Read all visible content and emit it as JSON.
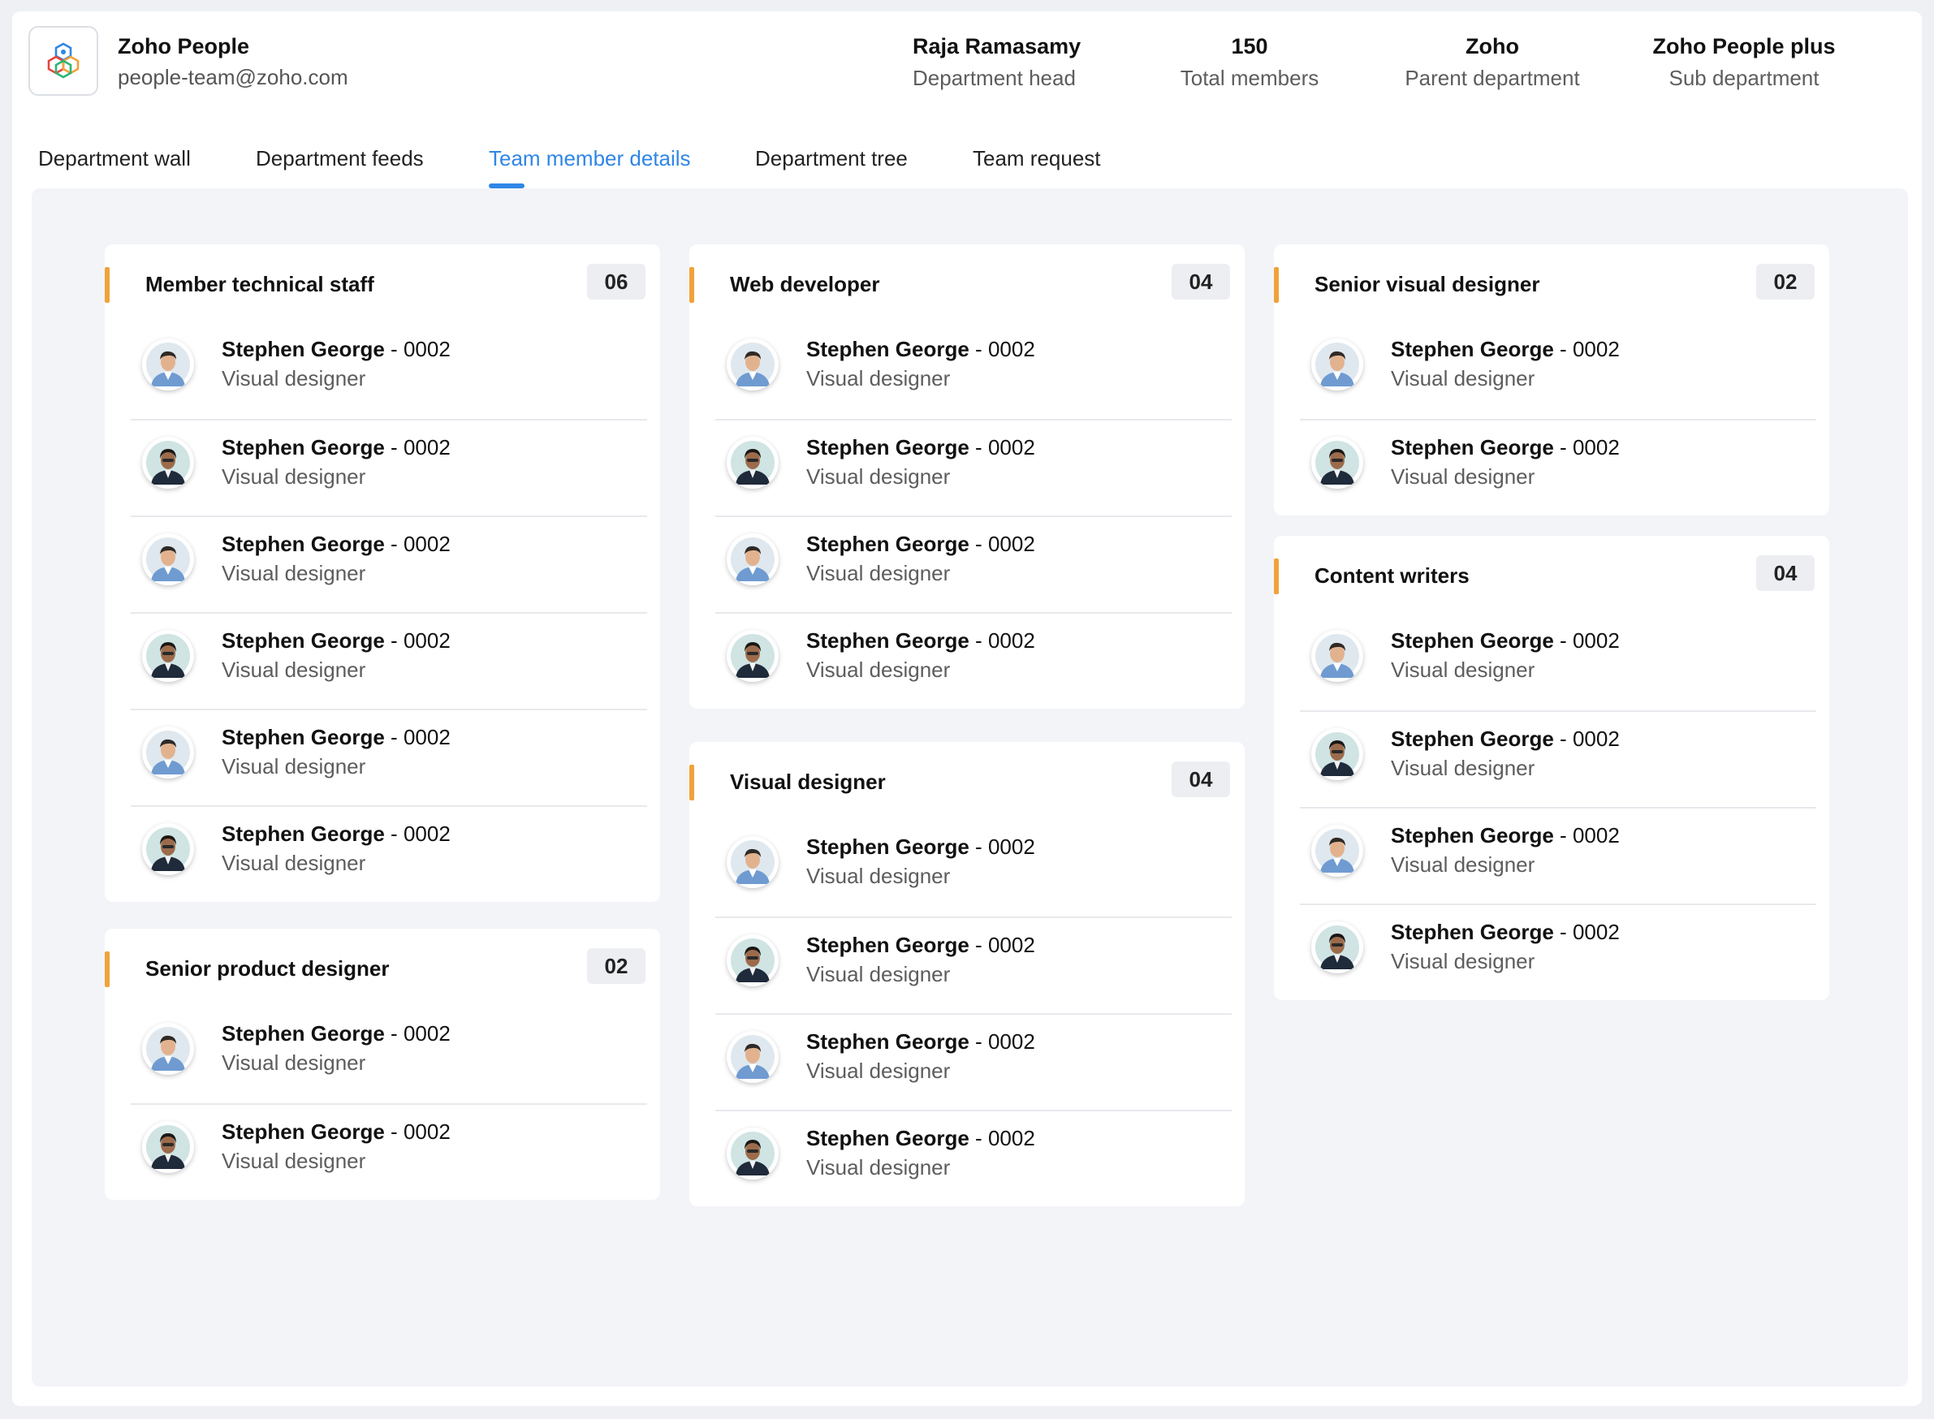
{
  "header": {
    "app_name": "Zoho People",
    "email": "people-team@zoho.com",
    "stats": [
      {
        "value": "Raja Ramasamy",
        "label": "Department head"
      },
      {
        "value": "150",
        "label": "Total members"
      },
      {
        "value": "Zoho",
        "label": "Parent department"
      },
      {
        "value": "Zoho People plus",
        "label": "Sub department"
      }
    ]
  },
  "tabs": [
    {
      "label": "Department wall"
    },
    {
      "label": "Department feeds"
    },
    {
      "label": "Team member details",
      "active": true
    },
    {
      "label": "Department tree"
    },
    {
      "label": "Team request"
    }
  ],
  "colors": {
    "accent": "#2f86e6",
    "group_marker": "#f0a23a"
  },
  "groups": [
    {
      "title": "Member technical staff",
      "count": "06",
      "members": [
        {
          "name": "Stephen George",
          "id": "0002",
          "role": "Visual designer",
          "avatar": "avatar-light"
        },
        {
          "name": "Stephen George",
          "id": "0002",
          "role": "Visual designer",
          "avatar": "avatar-dark"
        },
        {
          "name": "Stephen George",
          "id": "0002",
          "role": "Visual designer",
          "avatar": "avatar-light"
        },
        {
          "name": "Stephen George",
          "id": "0002",
          "role": "Visual designer",
          "avatar": "avatar-dark"
        },
        {
          "name": "Stephen George",
          "id": "0002",
          "role": "Visual designer",
          "avatar": "avatar-light"
        },
        {
          "name": "Stephen George",
          "id": "0002",
          "role": "Visual designer",
          "avatar": "avatar-dark"
        }
      ]
    },
    {
      "title": "Senior product designer",
      "count": "02",
      "members": [
        {
          "name": "Stephen George",
          "id": "0002",
          "role": "Visual designer",
          "avatar": "avatar-light"
        },
        {
          "name": "Stephen George",
          "id": "0002",
          "role": "Visual designer",
          "avatar": "avatar-dark"
        }
      ]
    },
    {
      "title": "Web developer",
      "count": "04",
      "members": [
        {
          "name": "Stephen George",
          "id": "0002",
          "role": "Visual designer",
          "avatar": "avatar-light"
        },
        {
          "name": "Stephen George",
          "id": "0002",
          "role": "Visual designer",
          "avatar": "avatar-dark"
        },
        {
          "name": "Stephen George",
          "id": "0002",
          "role": "Visual designer",
          "avatar": "avatar-light"
        },
        {
          "name": "Stephen George",
          "id": "0002",
          "role": "Visual designer",
          "avatar": "avatar-dark"
        }
      ]
    },
    {
      "title": "Visual designer",
      "count": "04",
      "members": [
        {
          "name": "Stephen George",
          "id": "0002",
          "role": "Visual designer",
          "avatar": "avatar-light"
        },
        {
          "name": "Stephen George",
          "id": "0002",
          "role": "Visual designer",
          "avatar": "avatar-dark"
        },
        {
          "name": "Stephen George",
          "id": "0002",
          "role": "Visual designer",
          "avatar": "avatar-light"
        },
        {
          "name": "Stephen George",
          "id": "0002",
          "role": "Visual designer",
          "avatar": "avatar-dark"
        }
      ]
    },
    {
      "title": "Senior visual designer",
      "count": "02",
      "members": [
        {
          "name": "Stephen George",
          "id": "0002",
          "role": "Visual designer",
          "avatar": "avatar-light"
        },
        {
          "name": "Stephen George",
          "id": "0002",
          "role": "Visual designer",
          "avatar": "avatar-dark"
        }
      ]
    },
    {
      "title": "Content writers",
      "count": "04",
      "members": [
        {
          "name": "Stephen George",
          "id": "0002",
          "role": "Visual designer",
          "avatar": "avatar-light"
        },
        {
          "name": "Stephen George",
          "id": "0002",
          "role": "Visual designer",
          "avatar": "avatar-dark"
        },
        {
          "name": "Stephen George",
          "id": "0002",
          "role": "Visual designer",
          "avatar": "avatar-light"
        },
        {
          "name": "Stephen George",
          "id": "0002",
          "role": "Visual designer",
          "avatar": "avatar-dark"
        }
      ]
    }
  ]
}
